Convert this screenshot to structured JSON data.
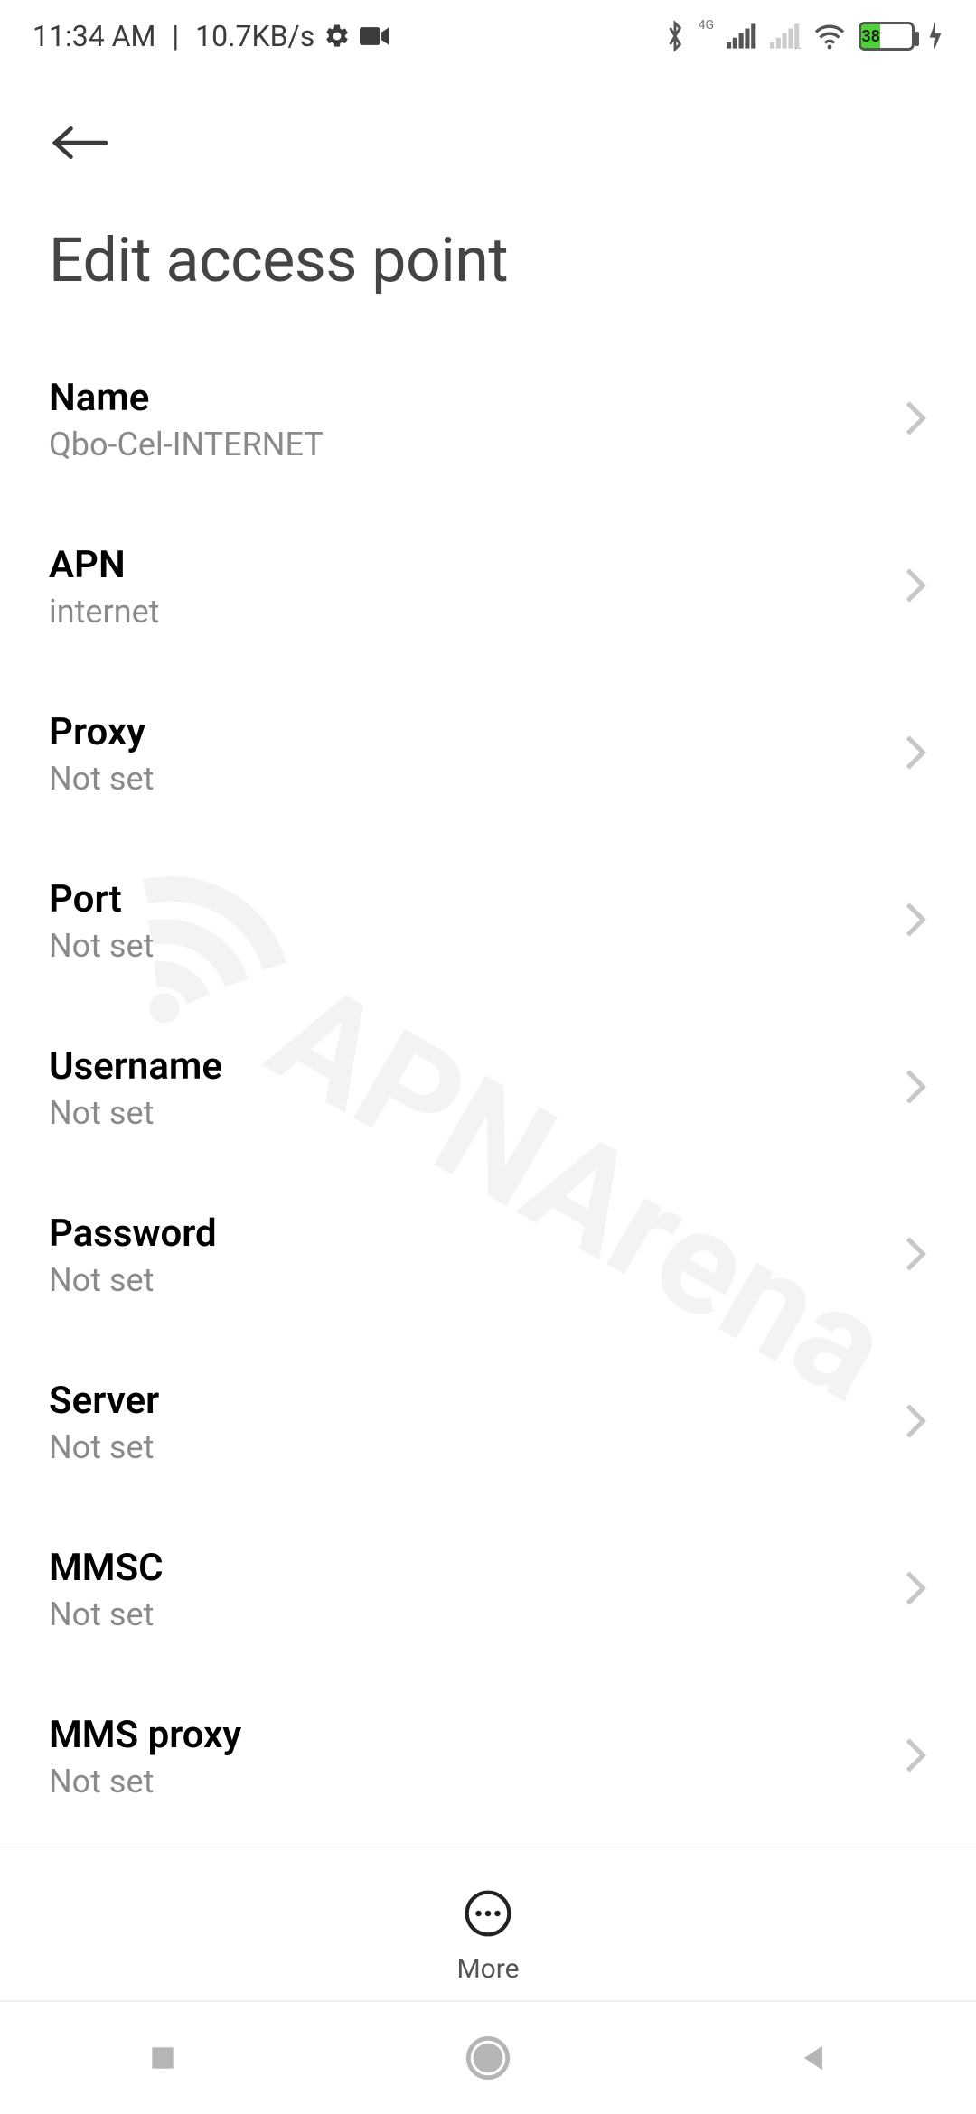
{
  "status": {
    "time": "11:34 AM",
    "net_speed": "10.7KB/s",
    "battery_pct": "38"
  },
  "header": {
    "title": "Edit access point"
  },
  "fields": [
    {
      "label": "Name",
      "value": "Qbo-Cel-INTERNET"
    },
    {
      "label": "APN",
      "value": "internet"
    },
    {
      "label": "Proxy",
      "value": "Not set"
    },
    {
      "label": "Port",
      "value": "Not set"
    },
    {
      "label": "Username",
      "value": "Not set"
    },
    {
      "label": "Password",
      "value": "Not set"
    },
    {
      "label": "Server",
      "value": "Not set"
    },
    {
      "label": "MMSC",
      "value": "Not set"
    },
    {
      "label": "MMS proxy",
      "value": "Not set"
    }
  ],
  "toolbar": {
    "more_label": "More"
  },
  "watermark": "APNArena"
}
